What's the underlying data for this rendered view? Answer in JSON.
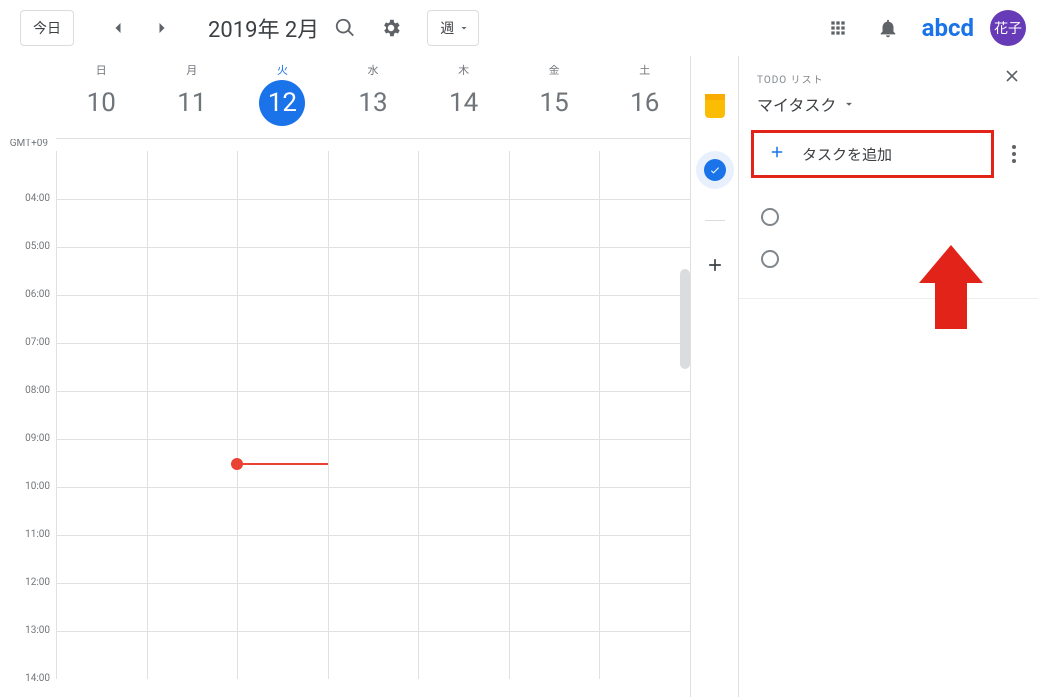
{
  "header": {
    "today_label": "今日",
    "title": "2019年 2月",
    "view_label": "週",
    "logo_text": "abcd",
    "avatar_text": "花子"
  },
  "calendar": {
    "timezone_label": "GMT+09",
    "days": [
      {
        "dow": "日",
        "num": "10",
        "today": false
      },
      {
        "dow": "月",
        "num": "11",
        "today": false
      },
      {
        "dow": "火",
        "num": "12",
        "today": true
      },
      {
        "dow": "水",
        "num": "13",
        "today": false
      },
      {
        "dow": "木",
        "num": "14",
        "today": false
      },
      {
        "dow": "金",
        "num": "15",
        "today": false
      },
      {
        "dow": "土",
        "num": "16",
        "today": false
      }
    ],
    "hours": [
      "04:00",
      "05:00",
      "06:00",
      "07:00",
      "08:00",
      "09:00",
      "10:00",
      "11:00",
      "12:00",
      "13:00",
      "14:00"
    ],
    "now": {
      "day_index": 2,
      "fraction_within_visible": 6.5
    }
  },
  "tasks": {
    "subtitle": "TODO リスト",
    "list_name": "マイタスク",
    "add_label": "タスクを追加",
    "items": [
      {
        "done": false,
        "text": ""
      },
      {
        "done": false,
        "text": ""
      }
    ]
  }
}
